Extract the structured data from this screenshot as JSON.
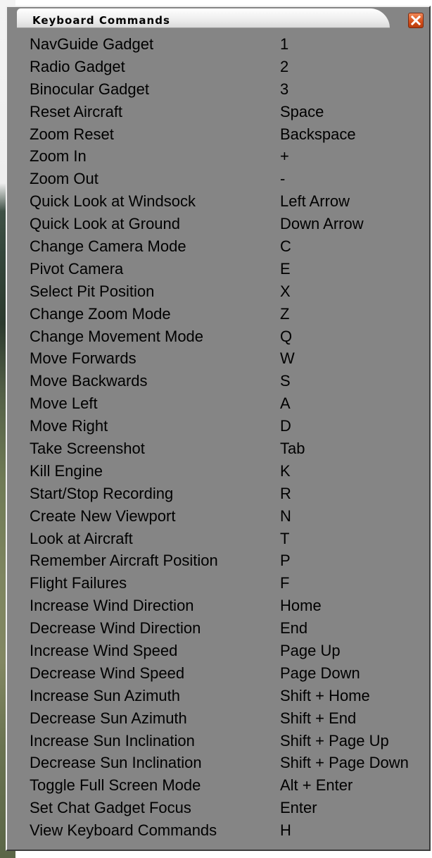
{
  "window": {
    "title": "Keyboard Commands",
    "close_label": "X"
  },
  "commands": [
    {
      "command": "NavGuide Gadget",
      "key": "1"
    },
    {
      "command": "Radio Gadget",
      "key": "2"
    },
    {
      "command": "Binocular Gadget",
      "key": "3"
    },
    {
      "command": "Reset Aircraft",
      "key": "Space"
    },
    {
      "command": "Zoom Reset",
      "key": "Backspace"
    },
    {
      "command": "Zoom In",
      "key": "+"
    },
    {
      "command": "Zoom Out",
      "key": "-"
    },
    {
      "command": "Quick Look at Windsock",
      "key": "Left Arrow"
    },
    {
      "command": "Quick Look at Ground",
      "key": "Down Arrow"
    },
    {
      "command": "Change Camera Mode",
      "key": "C"
    },
    {
      "command": "Pivot Camera",
      "key": "E"
    },
    {
      "command": "Select Pit Position",
      "key": "X"
    },
    {
      "command": "Change Zoom Mode",
      "key": "Z"
    },
    {
      "command": "Change Movement Mode",
      "key": "Q"
    },
    {
      "command": "Move Forwards",
      "key": "W"
    },
    {
      "command": "Move Backwards",
      "key": "S"
    },
    {
      "command": "Move Left",
      "key": "A"
    },
    {
      "command": "Move Right",
      "key": "D"
    },
    {
      "command": "Take Screenshot",
      "key": "Tab"
    },
    {
      "command": "Kill Engine",
      "key": "K"
    },
    {
      "command": "Start/Stop Recording",
      "key": "R"
    },
    {
      "command": "Create New Viewport",
      "key": "N"
    },
    {
      "command": "Look at Aircraft",
      "key": "T"
    },
    {
      "command": "Remember Aircraft Position",
      "key": "P"
    },
    {
      "command": "Flight Failures",
      "key": "F"
    },
    {
      "command": "Increase Wind Direction",
      "key": "Home"
    },
    {
      "command": "Decrease Wind Direction",
      "key": "End"
    },
    {
      "command": "Increase Wind Speed",
      "key": "Page Up"
    },
    {
      "command": "Decrease Wind Speed",
      "key": "Page Down"
    },
    {
      "command": "Increase Sun Azimuth",
      "key": "Shift + Home"
    },
    {
      "command": "Decrease Sun Azimuth",
      "key": "Shift + End"
    },
    {
      "command": "Increase Sun Inclination",
      "key": "Shift + Page Up"
    },
    {
      "command": "Decrease Sun Inclination",
      "key": "Shift + Page Down"
    },
    {
      "command": "Toggle Full Screen Mode",
      "key": "Alt + Enter"
    },
    {
      "command": "Set Chat Gadget Focus",
      "key": "Enter"
    },
    {
      "command": "View Keyboard Commands",
      "key": "H"
    }
  ],
  "colors": {
    "panel": "#858585",
    "text": "#000000",
    "close_button": "#d8521c"
  },
  "icons": {
    "close": "close-icon"
  }
}
